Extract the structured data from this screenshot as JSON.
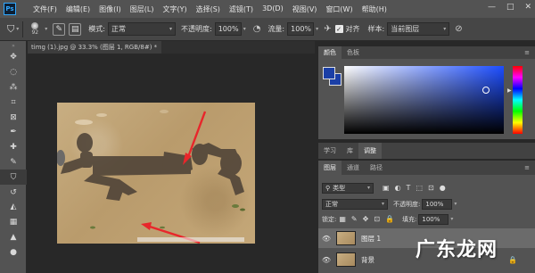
{
  "app": {
    "logo": "Ps"
  },
  "menu": [
    "文件(F)",
    "编辑(E)",
    "图像(I)",
    "图层(L)",
    "文字(Y)",
    "选择(S)",
    "滤镜(T)",
    "3D(D)",
    "视图(V)",
    "窗口(W)",
    "帮助(H)"
  ],
  "window_controls": {
    "minimize": "—",
    "maximize": "□",
    "close": "✕"
  },
  "options": {
    "brush_size": "92",
    "mode_label": "模式:",
    "mode_value": "正常",
    "opacity_label": "不透明度:",
    "opacity_value": "100%",
    "flow_label": "流量:",
    "flow_value": "100%",
    "align_label": "对齐",
    "sample_label": "样本:",
    "sample_value": "当前图层"
  },
  "document": {
    "tab_title": "timg (1).jpg @ 33.3% (图层 1, RGB/8#) *",
    "close": "×"
  },
  "color_panel": {
    "tabs": [
      "颜色",
      "色板"
    ]
  },
  "adjust_panel": {
    "tabs": [
      "学习",
      "库",
      "调整"
    ]
  },
  "layers_panel": {
    "tabs": [
      "图层",
      "通道",
      "路径"
    ],
    "filter_kind": "类型",
    "blend_mode": "正常",
    "opacity_label": "不透明度:",
    "opacity_value": "100%",
    "lock_label": "锁定:",
    "fill_label": "填充:",
    "fill_value": "100%",
    "layers": [
      {
        "name": "图层 1",
        "selected": true
      },
      {
        "name": "背景",
        "selected": false
      }
    ]
  },
  "colors": {
    "foreground": "#1b3fa6",
    "background": "#1b3fa6",
    "arrow": "#e8262b"
  },
  "watermark": "广东龙网"
}
